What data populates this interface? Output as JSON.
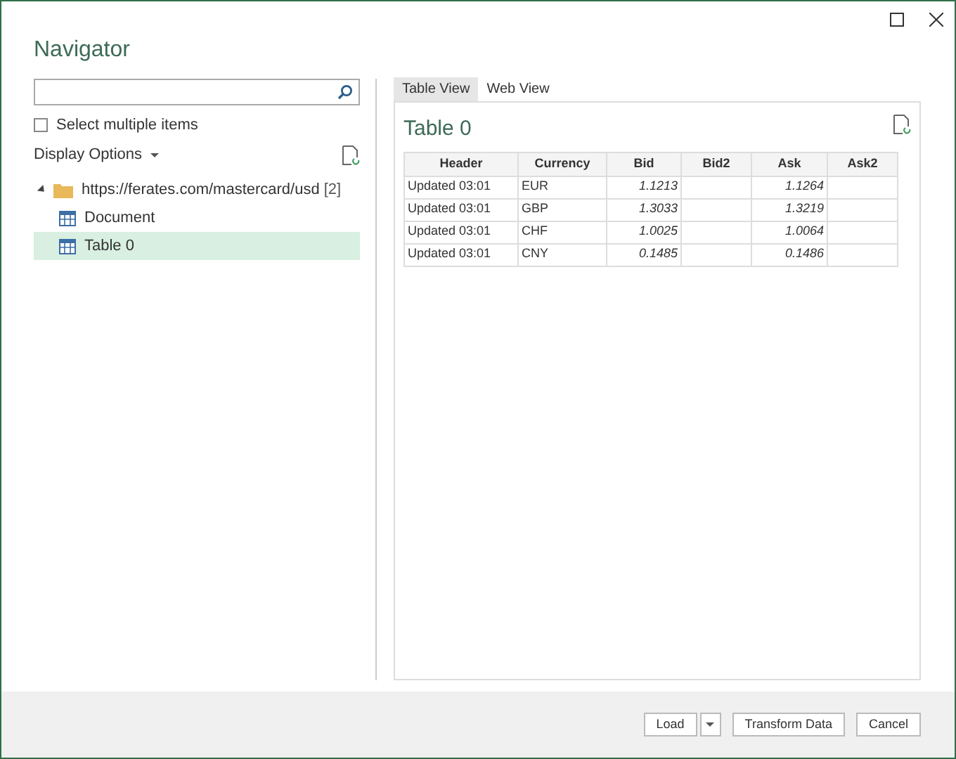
{
  "window": {
    "title": "Navigator"
  },
  "select_multiple": {
    "label": "Select multiple items",
    "checked": false
  },
  "display_options": {
    "label": "Display Options"
  },
  "tree": [
    {
      "label": "https://ferates.com/mastercard/usd",
      "count": "[2]",
      "kind": "folder",
      "expanded": true,
      "selected": false,
      "children": [
        {
          "label": "Document",
          "kind": "table",
          "selected": false
        },
        {
          "label": "Table 0",
          "kind": "table",
          "selected": true
        }
      ]
    }
  ],
  "tabs": [
    {
      "label": "Table View",
      "selected": true
    },
    {
      "label": "Web View",
      "selected": false
    }
  ],
  "preview": {
    "title": "Table 0"
  },
  "table": {
    "columns": [
      "Header",
      "Currency",
      "Bid",
      "Bid2",
      "Ask",
      "Ask2"
    ],
    "rows": [
      [
        "Updated 03:01",
        "EUR",
        "1.1213",
        "",
        "1.1264",
        ""
      ],
      [
        "Updated 03:01",
        "GBP",
        "1.3033",
        "",
        "1.3219",
        ""
      ],
      [
        "Updated 03:01",
        "CHF",
        "1.0025",
        "",
        "1.0064",
        ""
      ],
      [
        "Updated 03:01",
        "CNY",
        "0.1485",
        "",
        "0.1486",
        ""
      ]
    ]
  },
  "buttons": [
    {
      "label": "Load",
      "kind": "split"
    },
    {
      "label": "Transform Data",
      "kind": "plain"
    },
    {
      "label": "Cancel",
      "kind": "plain"
    }
  ]
}
